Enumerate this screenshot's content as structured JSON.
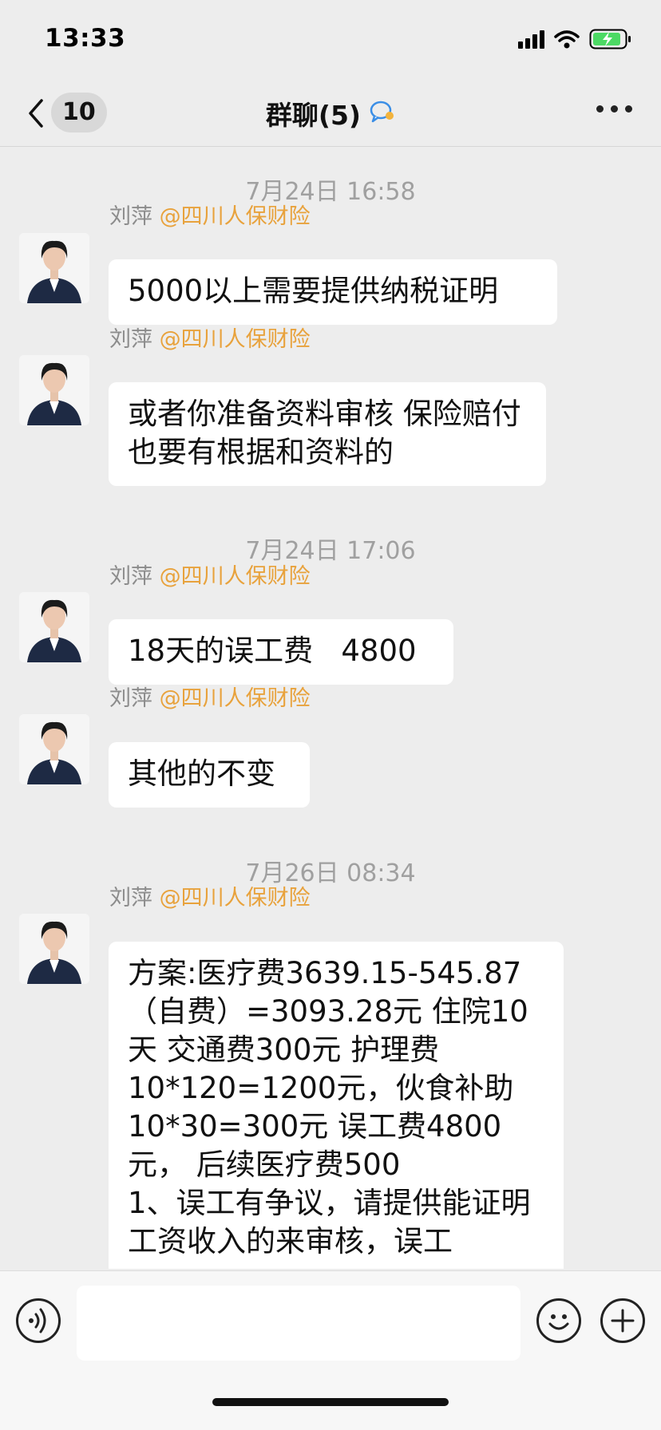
{
  "status_bar": {
    "time": "13:33"
  },
  "nav": {
    "back_count": "10",
    "title": "群聊(5)"
  },
  "chat": {
    "timestamps": [
      "7月24日 16:58",
      "7月24日 17:06",
      "7月26日 08:34"
    ],
    "messages": [
      {
        "sender": "刘萍",
        "sender_tag": "@四川人保财险",
        "text": "5000以上需要提供纳税证明"
      },
      {
        "sender": "刘萍",
        "sender_tag": "@四川人保财险",
        "text": "或者你准备资料审核 保险赔付也要有根据和资料的"
      },
      {
        "sender": "刘萍",
        "sender_tag": "@四川人保财险",
        "text": "18天的误工费   4800"
      },
      {
        "sender": "刘萍",
        "sender_tag": "@四川人保财险",
        "text": "其他的不变"
      },
      {
        "sender": "刘萍",
        "sender_tag": "@四川人保财险",
        "text": "方案:医疗费3639.15-545.87（自费）=3093.28元 住院10天 交通费300元 护理费10*120=1200元，伙食补助10*30=300元 误工费4800元， 后续医疗费500\n1、误工有争议，请提供能证明工资收入的来审核，误工"
      }
    ]
  },
  "input": {
    "placeholder": ""
  },
  "icons": {
    "back": "chevron-left-icon",
    "group": "group-chat-icon",
    "more": "more-icon",
    "voice": "voice-icon",
    "emoji": "emoji-icon",
    "plus": "plus-icon",
    "signal": "signal-icon",
    "wifi": "wifi-icon",
    "battery": "battery-icon"
  },
  "colors": {
    "background": "#ededed",
    "bubble": "#ffffff",
    "sender_tag": "#e8a23c",
    "battery": "#4cd964"
  }
}
